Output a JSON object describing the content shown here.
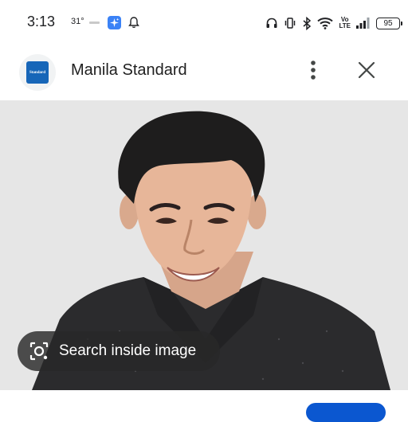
{
  "status_bar": {
    "time": "3:13",
    "temperature": "31°",
    "battery": "95",
    "network_badge_top": "Vo",
    "network_badge_bottom": "LTE",
    "icons": [
      "notification-icon",
      "gemini-icon",
      "bell-icon",
      "headphones-icon",
      "vibrate-icon",
      "bluetooth-icon",
      "wifi-icon",
      "volte-icon",
      "signal-icon",
      "battery-icon"
    ]
  },
  "header": {
    "site_title": "Manila Standard",
    "logo_text": "Standard",
    "more_icon": "more-vert-icon",
    "close_icon": "close-icon"
  },
  "image_viewer": {
    "search_button_label": "Search inside image",
    "search_icon": "lens-camera-icon"
  },
  "colors": {
    "accent_blue": "#0b57d0",
    "logo_blue": "#1766b8",
    "image_background": "#e6e6e6",
    "pill_background": "#282828"
  }
}
